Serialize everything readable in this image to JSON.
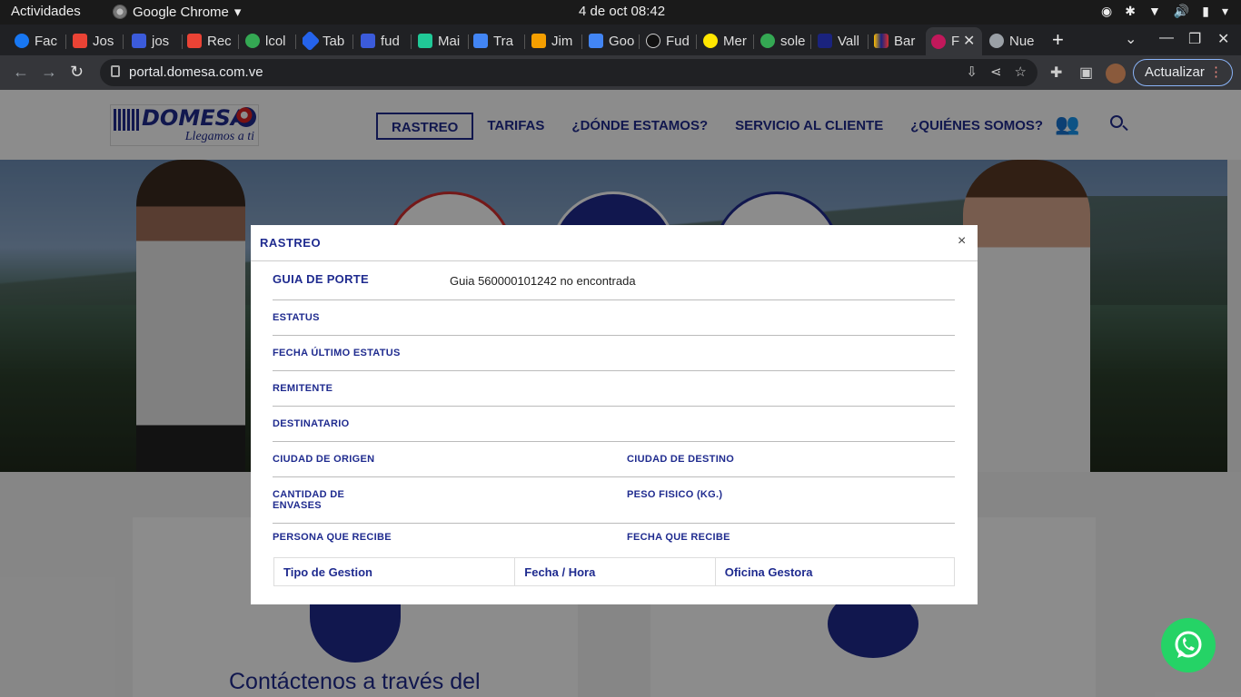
{
  "system": {
    "activities": "Actividades",
    "app_name": "Google Chrome",
    "clock": "4 de oct  08:42"
  },
  "tabs": [
    {
      "label": "Fac",
      "color": "#1877f2"
    },
    {
      "label": "Jos",
      "color": "#ea4335"
    },
    {
      "label": "jos",
      "color": "#3b5bdb"
    },
    {
      "label": "Rec",
      "color": "#ea4335"
    },
    {
      "label": "lcol",
      "color": "#34a853"
    },
    {
      "label": "Tab",
      "color": "#2563eb"
    },
    {
      "label": "fud",
      "color": "#3b5bdb"
    },
    {
      "label": "Mai",
      "color": "#20c997"
    },
    {
      "label": "Tra",
      "color": "#4285f4"
    },
    {
      "label": "Jim",
      "color": "#f59f00"
    },
    {
      "label": "Goo",
      "color": "#4285f4"
    },
    {
      "label": "Fud",
      "color": "#111111"
    },
    {
      "label": "Mer",
      "color": "#ffe600"
    },
    {
      "label": "sole",
      "color": "#34a853"
    },
    {
      "label": "Vall",
      "color": "#1a237e"
    },
    {
      "label": "Bar",
      "color": "#fbbc04"
    },
    {
      "label": "F",
      "color": "#c2185b"
    },
    {
      "label": "Nue",
      "color": "#9aa0a6"
    }
  ],
  "browser": {
    "url": "portal.domesa.com.ve",
    "update_label": "Actualizar"
  },
  "site": {
    "brand": "DOMESA",
    "slogan": "Llegamos a ti",
    "menu": [
      "RASTREO",
      "TARIFAS",
      "¿DÓNDE ESTAMOS?",
      "SERVICIO AL CLIENTE",
      "¿QUIÉNES SOMOS?"
    ],
    "contact_text": "Contáctenos a través del",
    "accent": "#1f2b8f"
  },
  "modal": {
    "title": "RASTREO",
    "close": "×",
    "guia_label": "GUIA DE PORTE",
    "guia_value": "Guia 560000101242 no encontrada",
    "estatus": "ESTATUS",
    "fecha_ultimo": "FECHA ÚLTIMO ESTATUS",
    "remitente": "REMITENTE",
    "destinatario": "DESTINATARIO",
    "ciudad_origen": "CIUDAD DE ORIGEN",
    "ciudad_destino": "CIUDAD DE DESTINO",
    "cantidad_envases": "CANTIDAD DE ENVASES",
    "peso_fisico": "PESO FISICO (KG.)",
    "persona_recibe": "PERSONA QUE RECIBE",
    "fecha_recibe": "FECHA QUE RECIBE",
    "table_headers": [
      "Tipo de Gestion",
      "Fecha / Hora",
      "Oficina Gestora"
    ]
  }
}
